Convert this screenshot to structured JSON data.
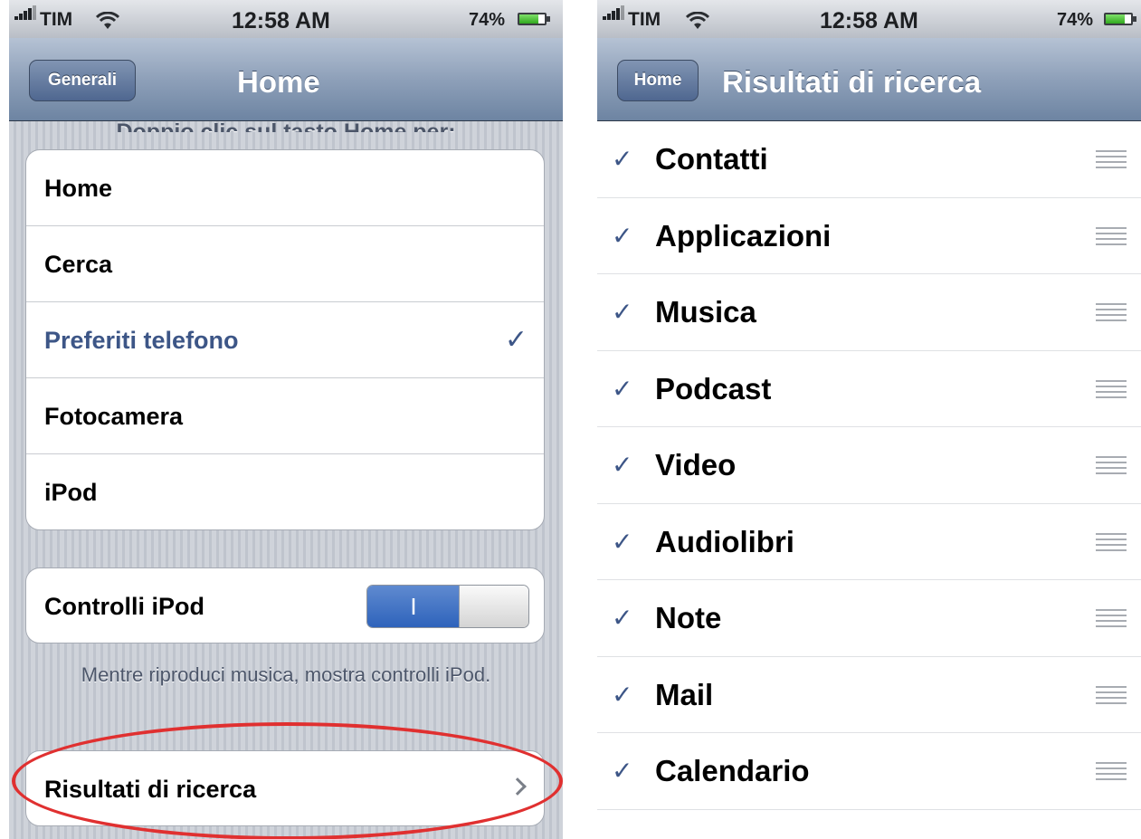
{
  "left_screen": {
    "statusbar": {
      "carrier": "TIM",
      "time": "12:58 AM",
      "battery_pct": "74%",
      "battery_level": 0.74
    },
    "navbar": {
      "back_label": "Generali",
      "title": "Home"
    },
    "section_header": "Doppio clic sul tasto Home per:",
    "home_options": [
      {
        "label": "Home",
        "selected": false
      },
      {
        "label": "Cerca",
        "selected": false
      },
      {
        "label": "Preferiti telefono",
        "selected": true
      },
      {
        "label": "Fotocamera",
        "selected": false
      },
      {
        "label": "iPod",
        "selected": false
      }
    ],
    "check_glyph": "✓",
    "ipod_controls": {
      "label": "Controlli iPod",
      "toggle_on_text": "I",
      "enabled": true
    },
    "footer": "Mentre riproduci musica, mostra controlli iPod.",
    "search_results_cell": {
      "label": "Risultati di ricerca"
    }
  },
  "right_screen": {
    "statusbar": {
      "carrier": "TIM",
      "time": "12:58 AM",
      "battery_pct": "74%",
      "battery_level": 0.74
    },
    "navbar": {
      "back_label": "Home",
      "title": "Risultati di ricerca"
    },
    "check_glyph": "✓",
    "items": [
      {
        "label": "Contatti"
      },
      {
        "label": "Applicazioni"
      },
      {
        "label": "Musica"
      },
      {
        "label": "Podcast"
      },
      {
        "label": "Video"
      },
      {
        "label": "Audiolibri"
      },
      {
        "label": "Note"
      },
      {
        "label": "Mail"
      },
      {
        "label": "Calendario"
      }
    ]
  },
  "colors": {
    "navbar_blue": "#6d84a2",
    "selection_blue": "#3d5687",
    "toggle_blue": "#2e63bb",
    "callout_red": "#e03030",
    "battery_green": "#31a91e"
  },
  "icons": [
    "signal-bars-icon",
    "wifi-icon",
    "battery-icon",
    "checkmark-icon",
    "chevron-right-icon",
    "reorder-grip-icon"
  ]
}
